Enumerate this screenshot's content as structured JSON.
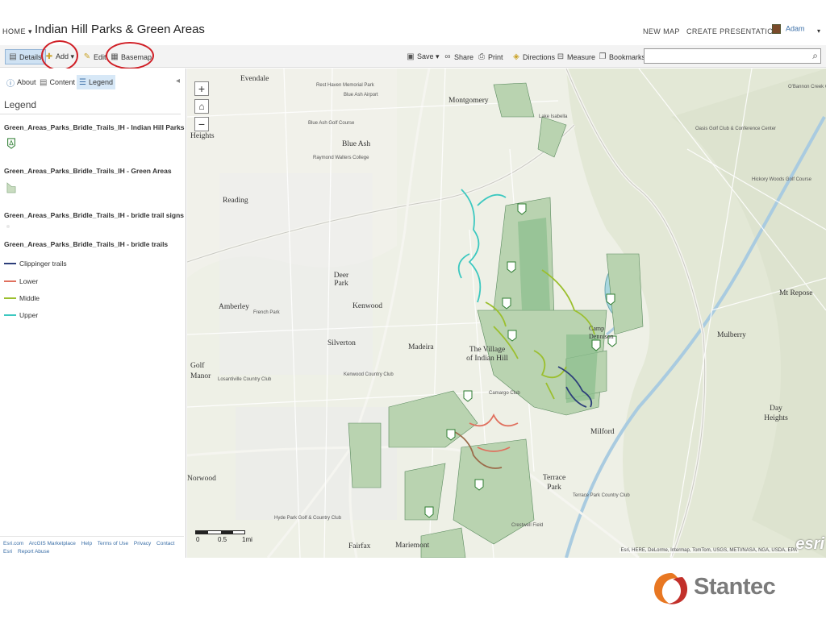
{
  "header": {
    "home_label": "HOME ▾",
    "map_title": "Indian Hill Parks & Green Areas",
    "new_map": "NEW MAP",
    "create_presentation": "CREATE PRESENTATION",
    "user_name": "Adam",
    "user_caret": "▾"
  },
  "toolbar": {
    "details": "Details",
    "add": "Add ▾",
    "edit": "Edit",
    "basemap": "Basemap",
    "save": "Save ▾",
    "share": "Share",
    "print": "Print",
    "directions": "Directions",
    "measure": "Measure",
    "bookmarks": "Bookmarks",
    "search_placeholder": "",
    "highlight_color": "#d01f26"
  },
  "panel": {
    "tabs": [
      "About",
      "Content",
      "Legend"
    ],
    "active_tab": "Legend",
    "legend_heading": "Legend",
    "layers": [
      {
        "title": "Green_Areas_Parks_Bridle_Trails_IH - Indian Hill Parks",
        "symbol": "park-marker-icon"
      },
      {
        "title": "Green_Areas_Parks_Bridle_Trails_IH - Green Areas",
        "symbol": "green-polygon-icon",
        "color": "#c9dcc0"
      },
      {
        "title": "Green_Areas_Parks_Bridle_Trails_IH - bridle trail signs",
        "symbol": "sign-point-icon"
      },
      {
        "title": "Green_Areas_Parks_Bridle_Trails_IH - bridle trails",
        "symbol": "line"
      }
    ],
    "trails": [
      {
        "label": "Clippinger trails",
        "color": "#2c3e7a"
      },
      {
        "label": "Lower",
        "color": "#e0705e"
      },
      {
        "label": "Middle",
        "color": "#9bbf2e"
      },
      {
        "label": "Upper",
        "color": "#3cc8c0"
      }
    ],
    "footer_links": [
      "Esri.com",
      "ArcGIS Marketplace",
      "Help",
      "Terms of Use",
      "Privacy",
      "Contact Esri",
      "Report Abuse"
    ]
  },
  "map": {
    "places": [
      "Evendale",
      "Montgomery",
      "Blue Ash",
      "Reading",
      "Deer Park",
      "Kenwood",
      "Amberley",
      "Silverton",
      "Madeira",
      "The Village of Indian Hill",
      "Golf Manor",
      "Mt Repose",
      "Mulberry",
      "Camp Dennison",
      "Milford",
      "Terrace Park",
      "Day Heights",
      "Norwood",
      "Fairfax",
      "Mariemont",
      "Heights"
    ],
    "small_places": [
      "Rest Haven Memorial Park",
      "Blue Ash Airport",
      "Blue Ash Golf Course",
      "Raymond Walters College",
      "French Park",
      "Kenwood Country Club",
      "Losantiville Country Club",
      "Camargo Club",
      "Terrace Park Country Club",
      "Hyde Park Golf & Country Club",
      "Oasis Golf Club & Conference Center",
      "Hickory Woods Golf Course",
      "O'Bannon Creek Golf Club",
      "Lake Isabella",
      "Crestwell Field"
    ],
    "zoom_in": "+",
    "home": "⌂",
    "zoom_out": "−",
    "scale_labels": [
      "0",
      "0.5",
      "1mi"
    ],
    "attribution": "Esri, HERE, DeLorme, Intermap, TomTom, USGS, METI/NASA, NGA, USDA, EPA",
    "esri_logo": "esri"
  },
  "branding": {
    "stantec": "Stantec",
    "stantec_color": "#e87722"
  }
}
